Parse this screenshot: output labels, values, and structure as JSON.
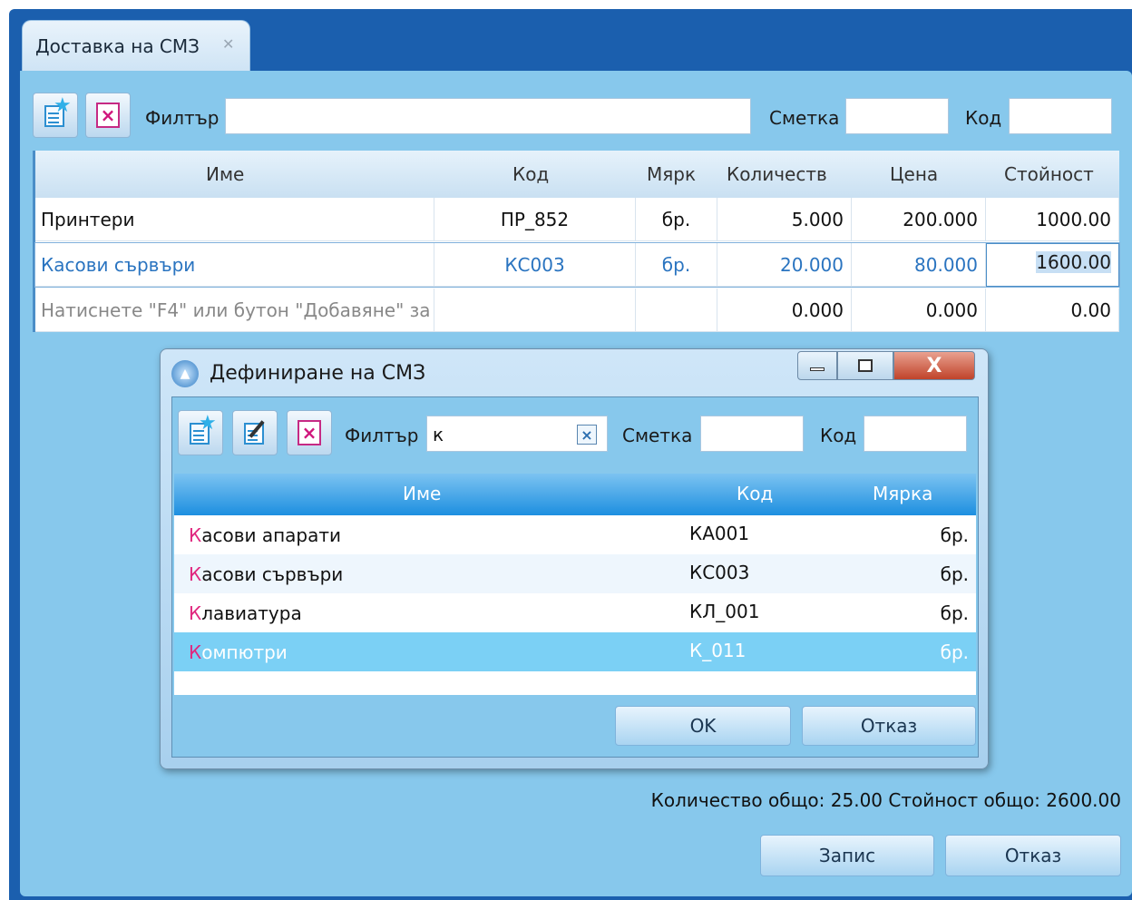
{
  "tab": {
    "title": "Доставка на СМЗ",
    "close": "✕"
  },
  "toolbar": {
    "filter_label": "Филтър",
    "filter_value": "",
    "account_label": "Сметка",
    "account_value": "",
    "code_label": "Код",
    "code_value": ""
  },
  "grid": {
    "headers": [
      "Име",
      "Код",
      "Мярк",
      "Количеств",
      "Цена",
      "Стойност"
    ],
    "rows": [
      {
        "name": "Принтери",
        "code": "ПР_852",
        "unit": "бр.",
        "qty": "5.000",
        "price": "200.000",
        "value": "1000.00"
      },
      {
        "name": "Касови сървъри",
        "code": "КС003",
        "unit": "бр.",
        "qty": "20.000",
        "price": "80.000",
        "value": "1600.00"
      },
      {
        "name": "Натиснете \"F4\" или бутон \"Добавяне\" за",
        "code": "",
        "unit": "",
        "qty": "0.000",
        "price": "0.000",
        "value": "0.00"
      }
    ]
  },
  "status": "Количество общо: 25.00  Стойност общо: 2600.00",
  "buttons": {
    "save": "Запис",
    "cancel": "Отказ"
  },
  "dialog": {
    "title": "Дефиниране на СМЗ",
    "filter_label": "Филтър",
    "filter_value": "к",
    "account_label": "Сметка",
    "account_value": "",
    "code_label": "Код",
    "code_value": "",
    "headers": [
      "Име",
      "Код",
      "Мярка"
    ],
    "rows": [
      {
        "first": "К",
        "rest": "асови апарати",
        "code": "КА001",
        "unit": "бр."
      },
      {
        "first": "К",
        "rest": "асови сървъри",
        "code": "КС003",
        "unit": "бр."
      },
      {
        "first": "К",
        "rest": "лавиатура",
        "code": "КЛ_001",
        "unit": "бр."
      },
      {
        "first": "К",
        "rest": "омпютри",
        "code": "К_011",
        "unit": "бр."
      }
    ],
    "ok": "OK",
    "cancel": "Отказ"
  }
}
